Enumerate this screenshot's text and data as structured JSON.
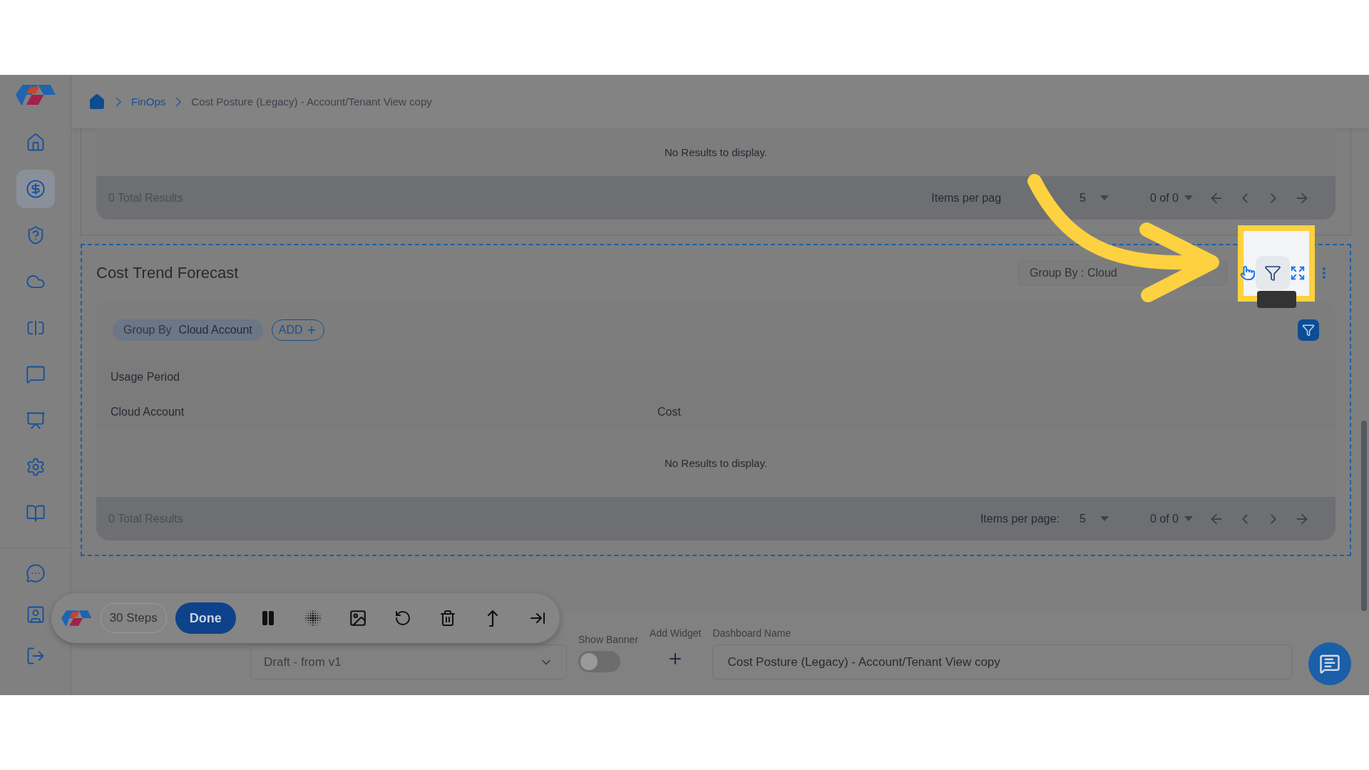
{
  "breadcrumb": [
    {
      "label": "FinOps",
      "kind": "link"
    },
    {
      "label": "Cost Posture (Legacy) - Account/Tenant View copy",
      "kind": "current"
    }
  ],
  "sidebar": {
    "items": [
      {
        "selected": false
      },
      {
        "selected": true
      },
      {
        "selected": false
      },
      {
        "selected": false
      },
      {
        "selected": false
      },
      {
        "selected": false
      },
      {
        "selected": false
      },
      {
        "selected": false
      },
      {
        "selected": false
      }
    ],
    "bottom_items": [
      {
        "selected": false
      },
      {
        "selected": false
      },
      {
        "selected": false
      }
    ]
  },
  "top_widget": {
    "empty_message": "No Results to display.",
    "total": "0 Total Results",
    "items_per_page_label": "Items per pag",
    "items_per_page": "5",
    "range": "0 of 0"
  },
  "widget": {
    "title": "Cost Trend Forecast",
    "group_by_select": "Group By : Cloud",
    "chip": {
      "label": "Group By",
      "value": "Cloud Account"
    },
    "add_button": "ADD",
    "header_rows": [
      [
        "Usage Period"
      ],
      [
        "Cloud Account",
        "Cost"
      ]
    ],
    "empty_message": "No Results to display.",
    "total": "0 Total Results",
    "items_per_page_label": "Items per page:",
    "items_per_page": "5",
    "range": "0 of 0"
  },
  "bottom_bar": {
    "version_select": "Draft - from v1",
    "show_banner": {
      "label": "Show Banner",
      "on": false
    },
    "add_widget": {
      "label": "Add Widget"
    },
    "dashboard_name": {
      "label": "Dashboard Name",
      "value": "Cost Posture (Legacy) - Account/Tenant View copy"
    }
  },
  "toolbar": {
    "steps": "30 Steps",
    "done": "Done"
  }
}
